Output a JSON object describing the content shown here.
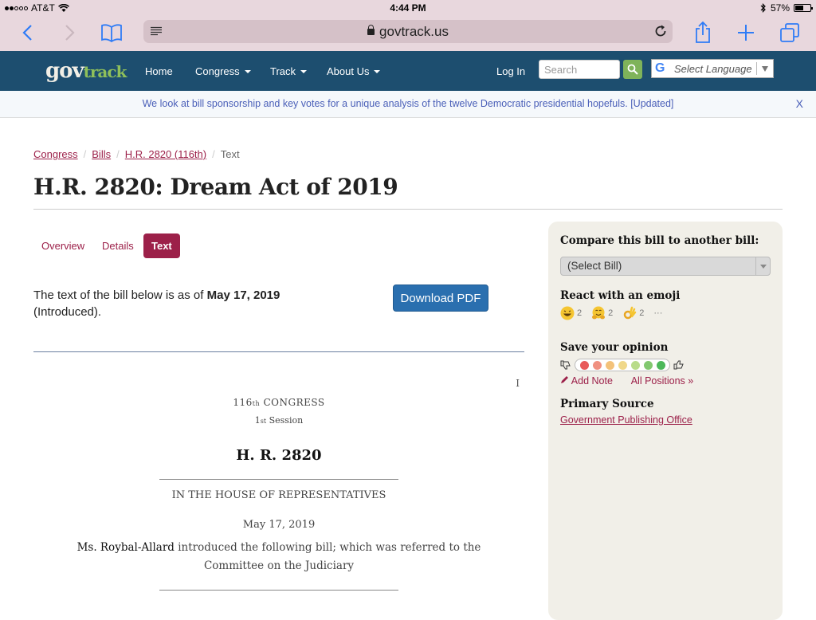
{
  "status": {
    "carrier": "AT&T",
    "time": "4:44 PM",
    "battery": "57%",
    "battery_level": 0.57
  },
  "browser": {
    "url": "govtrack.us",
    "icons": [
      "back-icon",
      "forward-icon",
      "bookmarks-icon",
      "reader-icon",
      "lock-icon",
      "reload-icon",
      "share-icon",
      "new-tab-icon",
      "tabs-icon"
    ]
  },
  "site": {
    "logo_gov": "gov",
    "logo_track": "track",
    "nav": {
      "home": "Home",
      "congress": "Congress",
      "track": "Track",
      "about": "About Us",
      "login": "Log In"
    },
    "search_placeholder": "Search",
    "language": "Select Language"
  },
  "banner": {
    "message": "We look at bill sponsorship and key votes for a unique analysis of the twelve Democratic presidential hopefuls. [Updated]",
    "close": "X"
  },
  "breadcrumb": {
    "items": [
      "Congress",
      "Bills",
      "H.R. 2820 (116th)"
    ],
    "current": "Text"
  },
  "page": {
    "title": "H.R. 2820: Dream Act of 2019",
    "tabs": [
      "Overview",
      "Details",
      "Text"
    ],
    "active_tab": "Text",
    "asof_prefix": "The text of the bill below is as of ",
    "asof_date": "May 17, 2019",
    "asof_status": "(Introduced).",
    "download_label": "Download PDF"
  },
  "bill": {
    "page_marker": "I",
    "congress_num": "116",
    "congress_suffix": "th",
    "congress_word": " CONGRESS",
    "session_num": "1",
    "session_suffix": "st",
    "session_word": " Session",
    "number": "H. R. 2820",
    "house": "IN THE HOUSE OF REPRESENTATIVES",
    "date": "May 17, 2019",
    "sponsor": "Ms. Roybal-Allard",
    "intro_text": " introduced the following bill; which was referred to the Committee on the Judiciary"
  },
  "sidebar": {
    "compare_heading": "Compare this bill to another bill:",
    "compare_select": "(Select Bill)",
    "react_heading": "React with an emoji",
    "reactions": [
      {
        "icon": "grin-emoji",
        "count": "2"
      },
      {
        "icon": "hug-emoji",
        "count": "2"
      },
      {
        "icon": "ok-hand-emoji",
        "count": "2"
      }
    ],
    "more": "···",
    "opinion_heading": "Save your opinion",
    "opinion_colors": [
      "#e85a5a",
      "#f09080",
      "#f3c27a",
      "#f0d88a",
      "#b9dc8a",
      "#82c870",
      "#4cb85a"
    ],
    "add_note": "Add Note",
    "all_positions": "All Positions »",
    "source_heading": "Primary Source",
    "source_link": "Government Publishing Office"
  }
}
